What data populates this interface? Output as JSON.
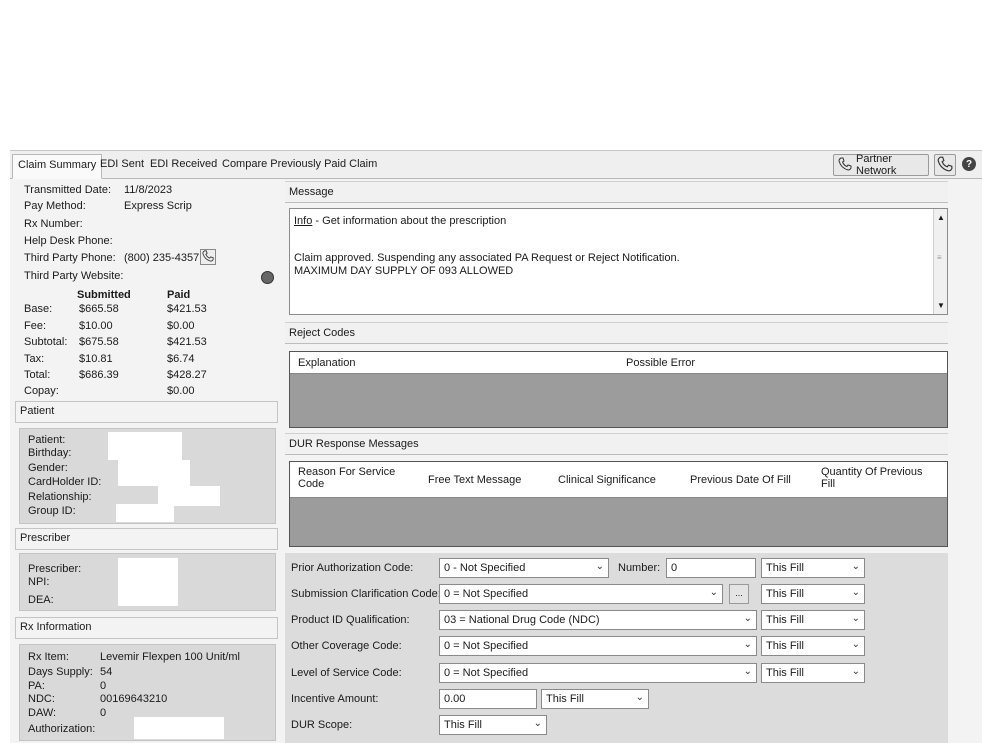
{
  "tabs": [
    "Claim Summary",
    "EDI Sent",
    "EDI Received",
    "Compare Previously Paid Claim"
  ],
  "header_buttons": {
    "partner_network": "Partner Network"
  },
  "summary": {
    "transmitted_date_label": "Transmitted Date:",
    "transmitted_date": "11/8/2023",
    "pay_method_label": "Pay Method:",
    "pay_method": "Express Scrip",
    "rx_number_label": "Rx Number:",
    "help_desk_label": "Help Desk Phone:",
    "third_party_phone_label": "Third Party Phone:",
    "third_party_phone": "(800) 235-4357",
    "third_party_website_label": "Third Party Website:"
  },
  "amounts": {
    "col_submitted": "Submitted",
    "col_paid": "Paid",
    "rows": [
      {
        "label": "Base:",
        "submitted": "$665.58",
        "paid": "$421.53"
      },
      {
        "label": "Fee:",
        "submitted": "$10.00",
        "paid": "$0.00"
      },
      {
        "label": "Subtotal:",
        "submitted": "$675.58",
        "paid": "$421.53"
      },
      {
        "label": "Tax:",
        "submitted": "$10.81",
        "paid": "$6.74"
      },
      {
        "label": "Total:",
        "submitted": "$686.39",
        "paid": "$428.27"
      },
      {
        "label": "Copay:",
        "submitted": "",
        "paid": "$0.00"
      }
    ]
  },
  "patient": {
    "title": "Patient",
    "labels": [
      "Patient:",
      "Birthday:",
      "Gender:",
      "CardHolder ID:",
      "Relationship:",
      "Group ID:"
    ]
  },
  "prescriber": {
    "title": "Prescriber",
    "labels": [
      "Prescriber:",
      "NPI:",
      "DEA:"
    ]
  },
  "rx_info": {
    "title": "Rx Information",
    "rows": [
      {
        "label": "Rx Item:",
        "value": "Levemir Flexpen 100 Unit/ml"
      },
      {
        "label": "Days Supply:",
        "value": "54"
      },
      {
        "label": "PA:",
        "value": "0"
      },
      {
        "label": "NDC:",
        "value": "00169643210"
      },
      {
        "label": "DAW:",
        "value": "0"
      },
      {
        "label": "Authorization:",
        "value": ""
      }
    ]
  },
  "message": {
    "title": "Message",
    "info_link": "Info",
    "info_text": " - Get information about the prescription",
    "line1": "Claim approved. Suspending any associated PA Request or Reject Notification.",
    "line2": "MAXIMUM DAY SUPPLY OF 093 ALLOWED"
  },
  "reject_codes": {
    "title": "Reject Codes",
    "columns": [
      "Explanation",
      "Possible Error"
    ]
  },
  "dur": {
    "title": "DUR Response Messages",
    "columns": [
      "Reason For Service Code",
      "Free Text Message",
      "Clinical Significance",
      "Previous Date Of Fill",
      "Quantity Of Previous Fill"
    ]
  },
  "form": {
    "prior_auth_label": "Prior Authorization Code:",
    "prior_auth_value": "0 - Not Specified",
    "number_label": "Number:",
    "number_value": "0",
    "submission_label": "Submission Clarification Code:",
    "submission_value": "0 = Not Specified",
    "product_id_label": "Product ID Qualification:",
    "product_id_value": "03 = National Drug Code (NDC)",
    "other_cov_label": "Other Coverage Code:",
    "other_cov_value": "0 = Not Specified",
    "level_label": "Level of Service Code:",
    "level_value": "0 = Not Specified",
    "incentive_label": "Incentive Amount:",
    "incentive_value": "0.00",
    "dur_scope_label": "DUR Scope:",
    "dur_scope_value": "This Fill",
    "this_fill": "This Fill",
    "dots": "..."
  }
}
